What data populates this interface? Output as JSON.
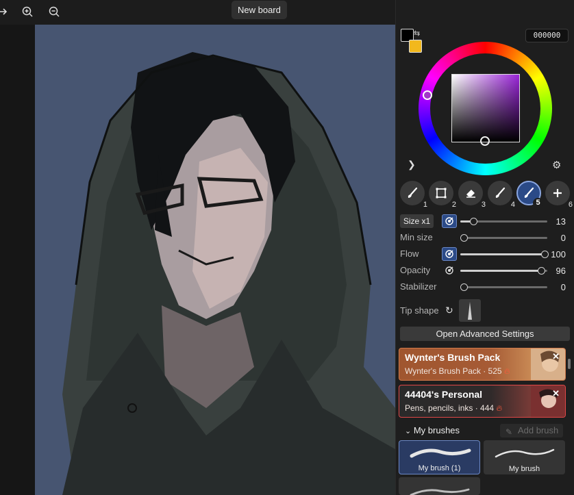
{
  "topbar": {
    "board_button": "New board",
    "icons": [
      "back-arrow-icon",
      "zoom-in-icon",
      "zoom-out-icon"
    ]
  },
  "color": {
    "primary": "#000000",
    "secondary": "#f2b81d",
    "hex_value": "000000",
    "hue_color": "#9a24d8"
  },
  "presets": [
    {
      "num": "1",
      "active": false
    },
    {
      "num": "2",
      "active": false
    },
    {
      "num": "3",
      "active": false
    },
    {
      "num": "4",
      "active": false
    },
    {
      "num": "5",
      "active": true
    },
    {
      "num": "6",
      "active": false
    }
  ],
  "settings": {
    "size_btn": "Size x1",
    "size_value": "13",
    "min_size_label": "Min size",
    "min_size_value": "0",
    "flow_label": "Flow",
    "flow_value": "100",
    "opacity_label": "Opacity",
    "opacity_value": "96",
    "stabilizer_label": "Stabilizer",
    "stabilizer_value": "0",
    "tip_shape_label": "Tip shape",
    "advanced_button": "Open Advanced Settings"
  },
  "packs": [
    {
      "title": "Wynter's Brush Pack",
      "sub": "Wynter's Brush Pack · 525",
      "accent": "#d27a4a"
    },
    {
      "title": "44404's Personal",
      "sub": "Pens, pencils, inks · 444",
      "accent": "#e04848"
    }
  ],
  "my_brushes": {
    "header": "My brushes",
    "add_button": "Add brush",
    "items": [
      {
        "name": "My brush (1)",
        "selected": true
      },
      {
        "name": "My brush",
        "selected": false
      }
    ]
  }
}
